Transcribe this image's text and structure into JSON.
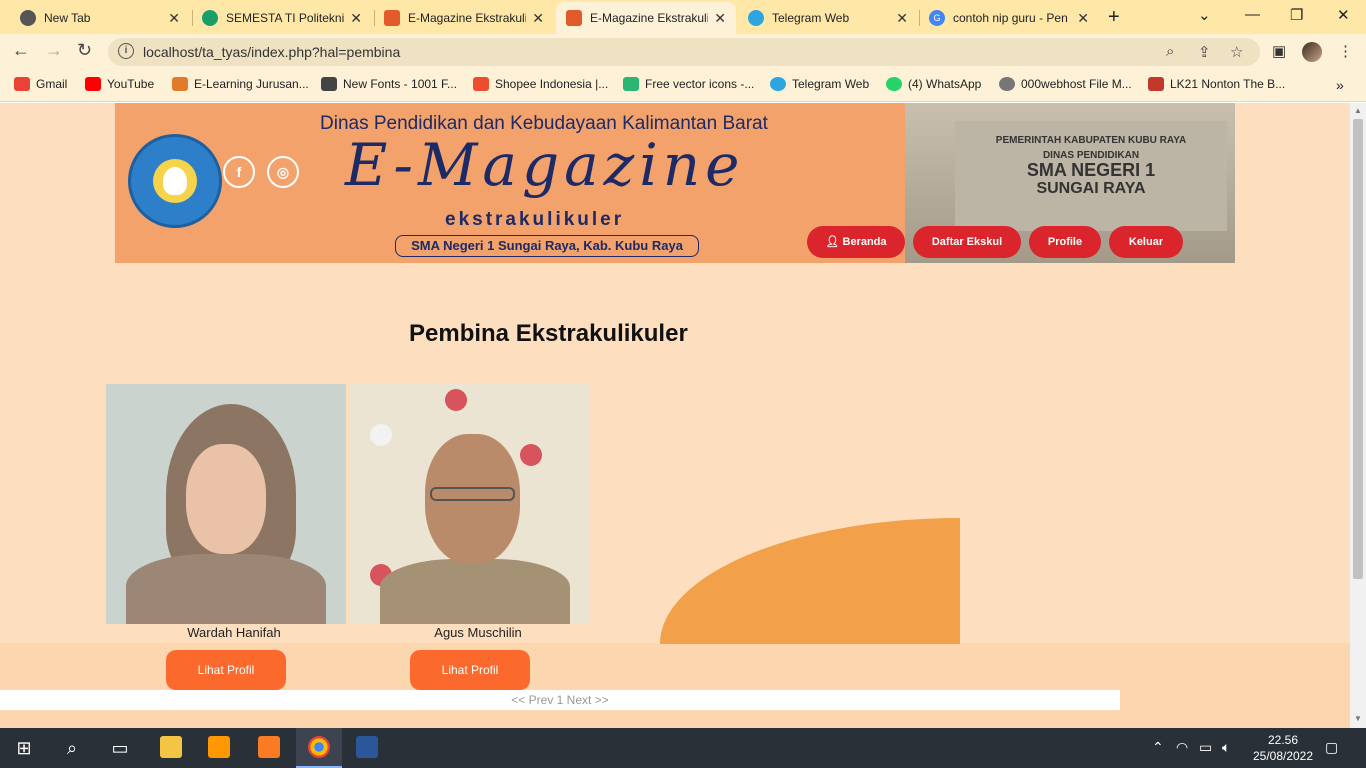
{
  "browser": {
    "tabs": [
      {
        "title": "New Tab",
        "active": false,
        "favicon_color": "#555555"
      },
      {
        "title": "SEMESTA TI Politeknik",
        "active": false,
        "favicon_color": "#1a9e6a"
      },
      {
        "title": "E-Magazine Ekstrakuli",
        "active": false,
        "favicon_color": "#e05a2b"
      },
      {
        "title": "E-Magazine Ekstrakuli",
        "active": true,
        "favicon_color": "#e05a2b"
      },
      {
        "title": "Telegram Web",
        "active": false,
        "favicon_color": "#2ca5e0"
      },
      {
        "title": "contoh nip guru - Pen",
        "active": false,
        "favicon_color": "#4285f4"
      }
    ],
    "new_tab": "+",
    "url": "localhost/ta_tyas/index.php?hal=pembina",
    "bookmarks": [
      {
        "label": "Gmail",
        "color": "#ea4335"
      },
      {
        "label": "YouTube",
        "color": "#ff0000"
      },
      {
        "label": "E-Learning Jurusan...",
        "color": "#e07b2b"
      },
      {
        "label": "New Fonts - 1001 F...",
        "color": "#444444"
      },
      {
        "label": "Shopee Indonesia |...",
        "color": "#ee4d2d"
      },
      {
        "label": "Free vector icons -...",
        "color": "#2bb673"
      },
      {
        "label": "Telegram Web",
        "color": "#2ca5e0"
      },
      {
        "label": "(4) WhatsApp",
        "color": "#25d366"
      },
      {
        "label": "000webhost File M...",
        "color": "#777777"
      },
      {
        "label": "LK21 Nonton The B...",
        "color": "#c0392b"
      }
    ]
  },
  "site": {
    "banner": {
      "top_text": "Dinas Pendidikan dan Kebudayaan Kalimantan Barat",
      "title": "E-Magazine",
      "subtitle": "ekstrakulikuler",
      "school": "SMA Negeri 1 Sungai Raya, Kab. Kubu Raya",
      "sign_text": "PEMERINTAH KABUPATEN KUBU RAYA\nDINAS PENDIDIKAN\nSMA NEGERI 1\nSUNGAI RAYA"
    },
    "nav": [
      "Beranda",
      "Daftar Ekskul",
      "Profile",
      "Keluar"
    ],
    "heading": "Pembina Ekstrakulikuler",
    "cards": [
      {
        "name": "Wardah Hanifah",
        "button": "Lihat Profil"
      },
      {
        "name": "Agus Muschilin",
        "button": "Lihat Profil"
      }
    ],
    "pager": "<< Prev 1 Next >>"
  },
  "taskbar": {
    "time": "22.56",
    "date": "25/08/2022"
  },
  "colors": {
    "accent_red": "#d9252b",
    "button_orange": "#fb6a2c",
    "page_bg": "#fddfc0"
  }
}
